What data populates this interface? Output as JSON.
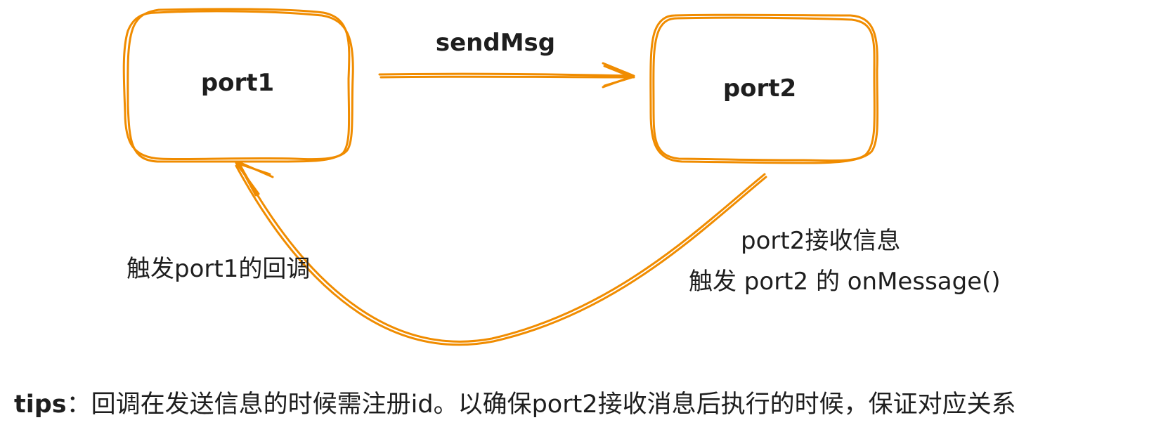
{
  "colors": {
    "stroke": "#f08c00",
    "text": "#1e1e1e",
    "background": "#ffffff"
  },
  "nodes": {
    "port1": {
      "label": "port1"
    },
    "port2": {
      "label": "port2"
    }
  },
  "edges": {
    "send": {
      "label": "sendMsg"
    },
    "callback": {
      "label": "触发port1的回调"
    }
  },
  "annotations": {
    "receive_line1": "port2接收信息",
    "receive_line2": "触发 port2 的 onMessage()"
  },
  "tips": {
    "prefix": "tips",
    "separator": "：",
    "text": "回调在发送信息的时候需注册id。以确保port2接收消息后执行的时候，保证对应关系"
  }
}
